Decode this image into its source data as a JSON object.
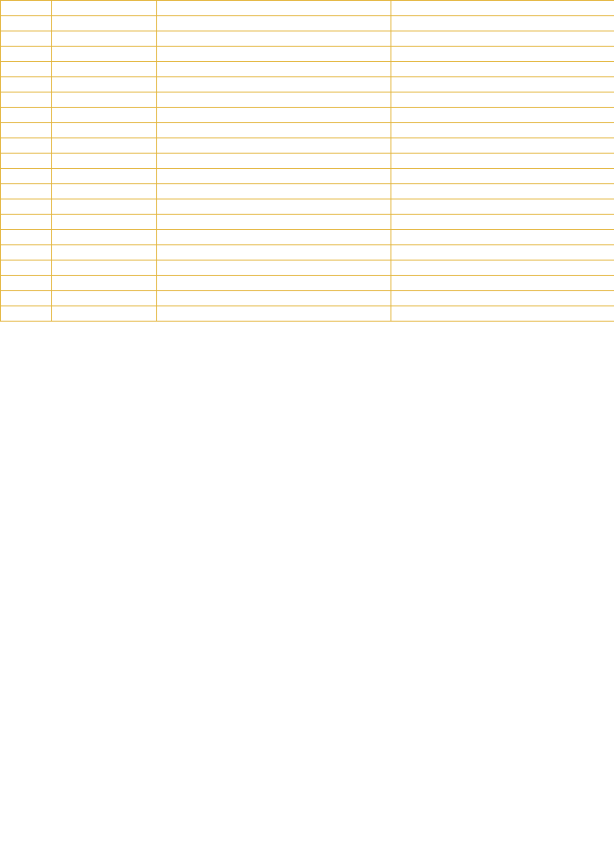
{
  "table": {
    "border_color": "#e3b53c",
    "column_count": 4,
    "rows": [
      [
        "",
        "",
        "",
        ""
      ],
      [
        "",
        "",
        "",
        ""
      ],
      [
        "",
        "",
        "",
        ""
      ],
      [
        "",
        "",
        "",
        ""
      ],
      [
        "",
        "",
        "",
        ""
      ],
      [
        "",
        "",
        "",
        ""
      ],
      [
        "",
        "",
        "",
        ""
      ],
      [
        "",
        "",
        "",
        ""
      ],
      [
        "",
        "",
        "",
        ""
      ],
      [
        "",
        "",
        "",
        ""
      ],
      [
        "",
        "",
        "",
        ""
      ],
      [
        "",
        "",
        "",
        ""
      ],
      [
        "",
        "",
        "",
        ""
      ],
      [
        "",
        "",
        "",
        ""
      ],
      [
        "",
        "",
        "",
        ""
      ],
      [
        "",
        "",
        "",
        ""
      ],
      [
        "",
        "",
        "",
        ""
      ],
      [
        "",
        "",
        "",
        ""
      ],
      [
        "",
        "",
        "",
        ""
      ],
      [
        "",
        "",
        "",
        ""
      ],
      [
        "",
        "",
        "",
        ""
      ]
    ]
  }
}
